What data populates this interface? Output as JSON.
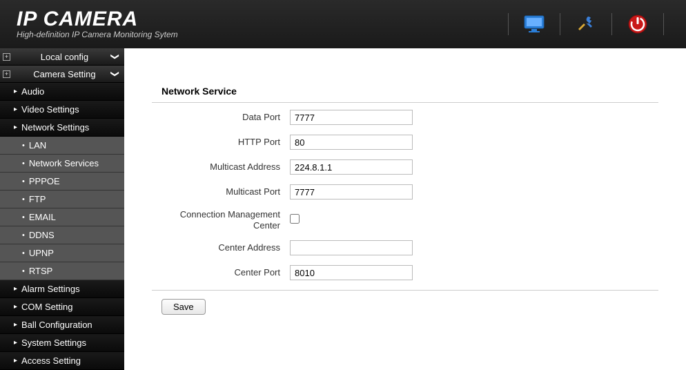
{
  "header": {
    "title": "IP CAMERA",
    "subtitle": "High-definition IP Camera Monitoring Sytem"
  },
  "sidebar": {
    "groups": [
      {
        "label": "Local config",
        "chevron": "❯"
      },
      {
        "label": "Camera Setting",
        "chevron": "❯"
      }
    ],
    "items_top": [
      {
        "label": "Audio"
      },
      {
        "label": "Video Settings"
      },
      {
        "label": "Network Settings"
      }
    ],
    "submenu": [
      {
        "label": "LAN"
      },
      {
        "label": "Network Services"
      },
      {
        "label": "PPPOE"
      },
      {
        "label": "FTP"
      },
      {
        "label": "EMAIL"
      },
      {
        "label": "DDNS"
      },
      {
        "label": "UPNP"
      },
      {
        "label": "RTSP"
      }
    ],
    "items_bottom": [
      {
        "label": "Alarm Settings"
      },
      {
        "label": "COM Setting"
      },
      {
        "label": "Ball Configuration"
      },
      {
        "label": "System Settings"
      },
      {
        "label": "Access Setting"
      }
    ]
  },
  "main": {
    "section_title": "Network Service",
    "fields": {
      "data_port": {
        "label": "Data Port",
        "value": "7777"
      },
      "http_port": {
        "label": "HTTP Port",
        "value": "80"
      },
      "multicast_address": {
        "label": "Multicast Address",
        "value": "224.8.1.1"
      },
      "multicast_port": {
        "label": "Multicast Port",
        "value": "7777"
      },
      "conn_mgmt": {
        "label": "Connection Management Center",
        "checked": false
      },
      "center_address": {
        "label": "Center Address",
        "value": ""
      },
      "center_port": {
        "label": "Center Port",
        "value": "8010"
      }
    },
    "save_label": "Save"
  }
}
